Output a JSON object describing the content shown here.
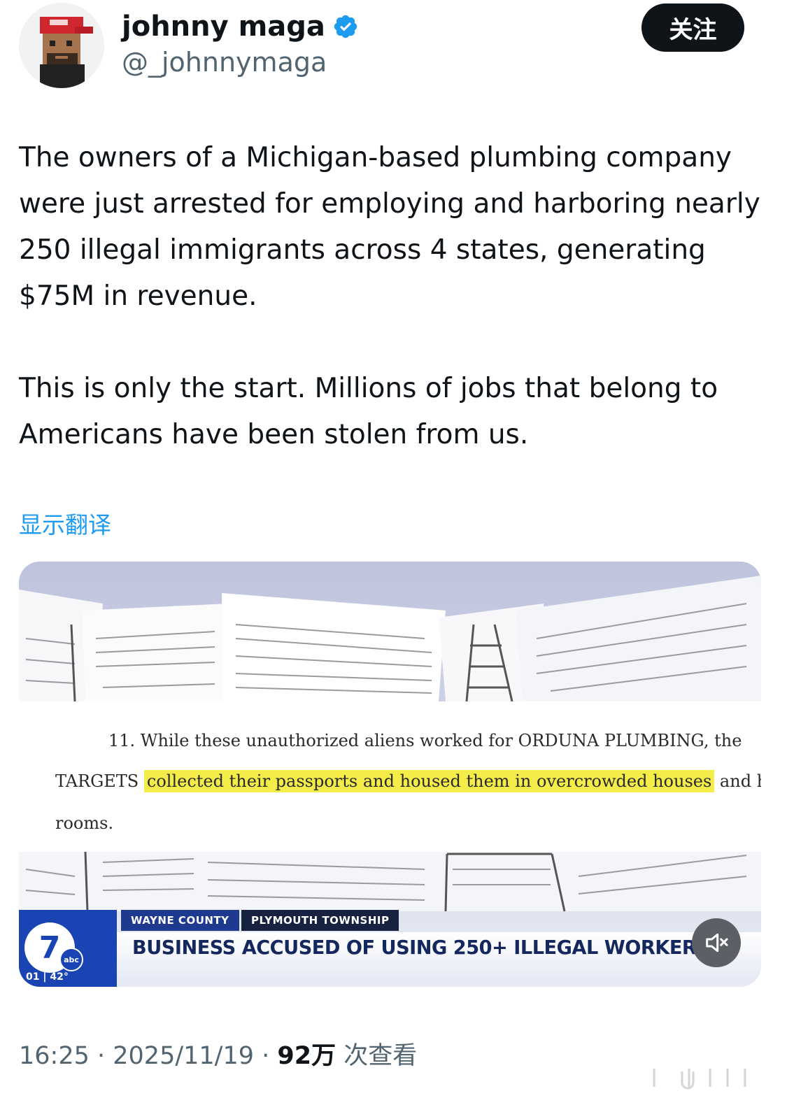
{
  "author": {
    "display_name": "johnny maga",
    "handle": "@_johnnymaga",
    "verified": true,
    "verified_icon": "verified-badge-icon",
    "avatar_icon": "pixel-avatar-red-cap"
  },
  "follow_button": {
    "label": "关注"
  },
  "tweet": {
    "paragraphs": [
      "The owners of a Michigan-based plumbing company were just arrested for employing and harboring nearly 250 illegal immigrants across 4 states, generating $75M in revenue.",
      "This is only the start. Millions of jobs that belong to Americans have been stolen from us."
    ]
  },
  "translate_link": {
    "label": "显示翻译"
  },
  "media": {
    "document": {
      "line1": "11.    While  these  unauthorized  aliens  worked  for  ORDUNA  PLUMBING,  the",
      "line2_before": "TARGETS ",
      "line2_highlight": "collected  their  passports  and  housed  them  in  overcrowded  houses",
      "line2_after": " and  hotel",
      "line3": "rooms."
    },
    "news": {
      "tag_county": "WAYNE COUNTY",
      "tag_township": "PLYMOUTH TOWNSHIP",
      "headline": "BUSINESS ACCUSED OF USING 250+ ILLEGAL WORKERS",
      "logo_number": "7",
      "logo_network": "abc",
      "weather": "01 | 42°"
    },
    "mute_icon": "speaker-muted-icon"
  },
  "meta": {
    "time": "16:25",
    "separator": " · ",
    "date": "2025/11/19",
    "views_count": "92万",
    "views_label": " 次查看"
  },
  "colors": {
    "accent_blue": "#1d9bf0",
    "text_primary": "#0f1419",
    "text_secondary": "#536471",
    "highlight": "#f4ec48",
    "news_blue": "#1a43b4"
  }
}
